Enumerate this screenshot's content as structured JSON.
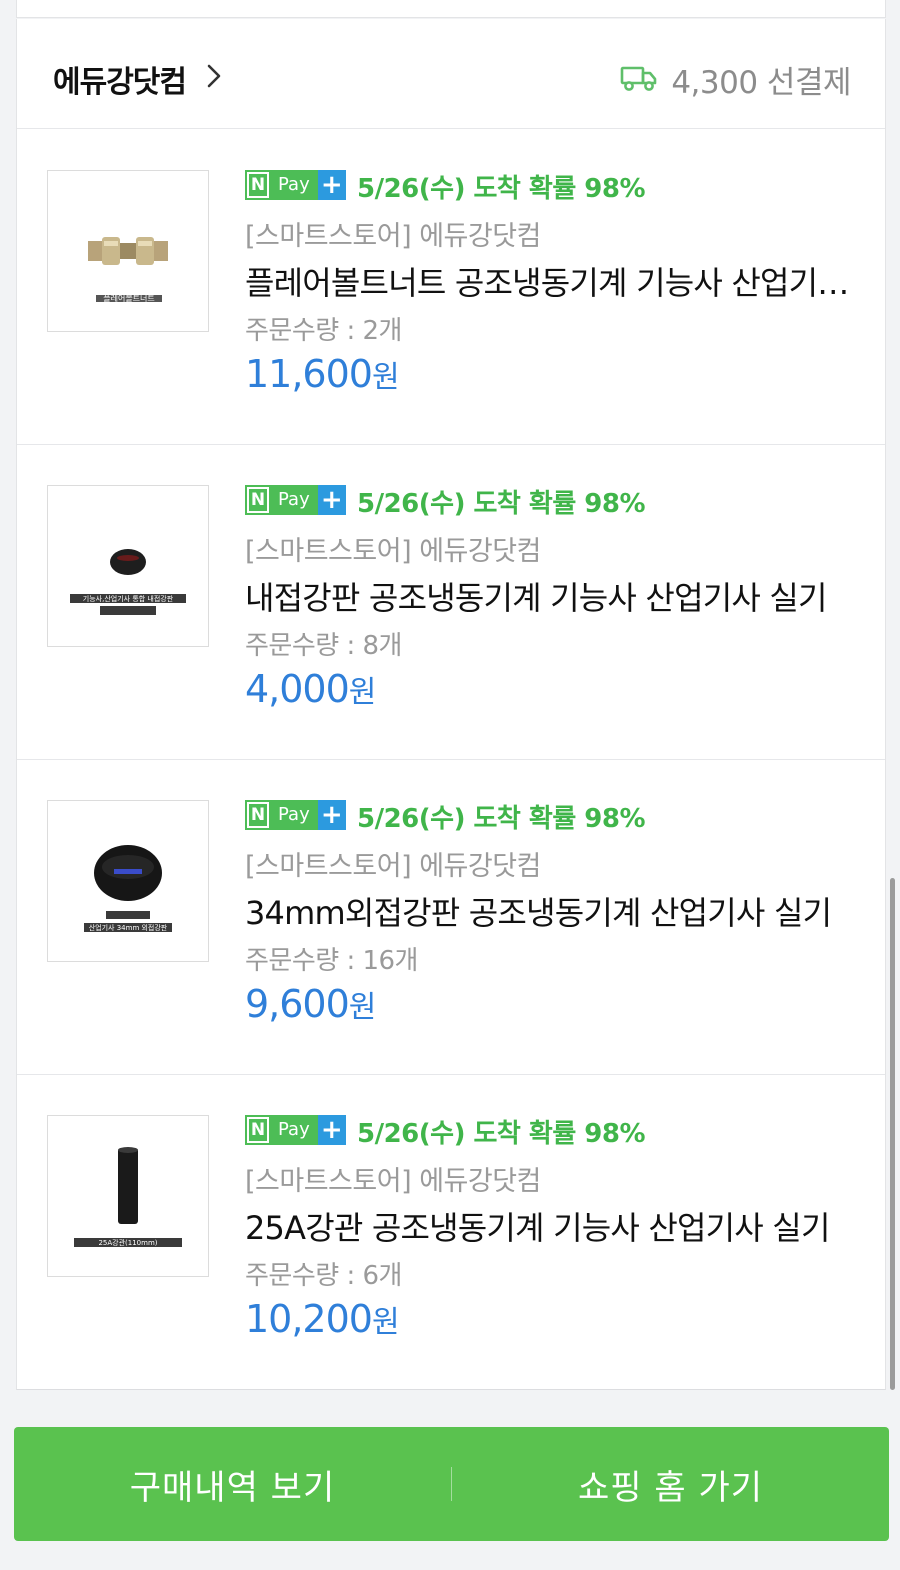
{
  "store": {
    "name": "에듀강닷컴",
    "shipping_fee": "4,300 선결제"
  },
  "items": [
    {
      "delivery": "5/26(수) 도착 확률 98%",
      "store_tag": "[스마트스토어] 에듀강닷컴",
      "title": "플레어볼트너트 공조냉동기계 기능사 산업기사 실기",
      "quantity": "주문수량 : 2개",
      "price": "11,600",
      "price_unit": "원",
      "thumb_caption": "플레어볼트너트"
    },
    {
      "delivery": "5/26(수) 도착 확률 98%",
      "store_tag": "[스마트스토어] 에듀강닷컴",
      "title": "내접강판 공조냉동기계 기능사 산업기사 실기",
      "quantity": "주문수량 : 8개",
      "price": "4,000",
      "price_unit": "원",
      "thumb_caption": "기능사,산업기사 통합 내접강판"
    },
    {
      "delivery": "5/26(수) 도착 확률 98%",
      "store_tag": "[스마트스토어] 에듀강닷컴",
      "title": "34mm외접강판 공조냉동기계 산업기사 실기",
      "quantity": "주문수량 : 16개",
      "price": "9,600",
      "price_unit": "원",
      "thumb_caption": "산업기사 34mm 외접강판"
    },
    {
      "delivery": "5/26(수) 도착 확률 98%",
      "store_tag": "[스마트스토어] 에듀강닷컴",
      "title": "25A강관 공조냉동기계 기능사 산업기사 실기",
      "quantity": "주문수량 : 6개",
      "price": "10,200",
      "price_unit": "원",
      "thumb_caption": "25A강관(110mm)"
    }
  ],
  "badge": {
    "n": "N",
    "pay": "Pay",
    "plus": "+"
  },
  "bottom": {
    "history_label": "구매내역 보기",
    "home_label": "쇼핑 홈 가기"
  },
  "colors": {
    "accent_green": "#40b54a",
    "button_green": "#5ac24f",
    "price_blue": "#2f7fd9",
    "npay_blue": "#2c9adf"
  }
}
